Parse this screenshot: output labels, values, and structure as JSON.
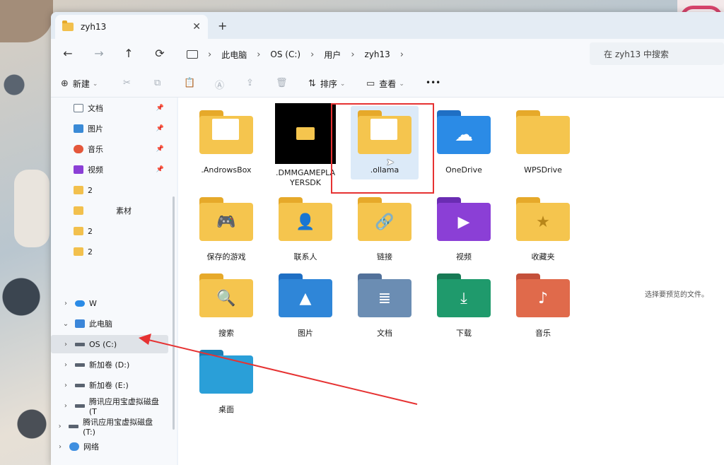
{
  "tab": {
    "title": "zyh13",
    "close": "✕",
    "new": "+"
  },
  "nav": {
    "back": "←",
    "forward": "→",
    "up": "↑",
    "refresh": "⟳"
  },
  "path": {
    "segments": [
      "此电脑",
      "OS (C:)",
      "用户",
      "zyh13"
    ],
    "sep": "›",
    "end": "›"
  },
  "search": {
    "placeholder": "在 zyh13 中搜索"
  },
  "toolbar": {
    "new": "新建",
    "new_icon": "⊕",
    "caret": "⌄",
    "cut_icon": "✂",
    "copy_icon": "⧉",
    "paste_icon": "📋",
    "rename_icon": "Ⓐ",
    "share_icon": "⇪",
    "delete_icon": "🗑",
    "sort_icon": "⇅",
    "sort": "排序",
    "view_icon": "▭",
    "view": "查看",
    "more": "•••"
  },
  "sidebar": {
    "quick": [
      {
        "label": "文档",
        "icon": "doc",
        "pin": "📌"
      },
      {
        "label": "图片",
        "icon": "pic",
        "pin": "📌"
      },
      {
        "label": "音乐",
        "icon": "music",
        "pin": "📌"
      },
      {
        "label": "视频",
        "icon": "video",
        "pin": "📌"
      },
      {
        "label": "2",
        "icon": "folder"
      },
      {
        "label": "素材",
        "icon": "folder"
      },
      {
        "label": "2",
        "icon": "folder"
      },
      {
        "label": "2",
        "icon": "folder"
      }
    ],
    "tree": [
      {
        "label": "W",
        "icon": "cloud",
        "chev": "›"
      },
      {
        "label": "此电脑",
        "icon": "pc",
        "chev": "⌄"
      },
      {
        "label": "OS (C:)",
        "icon": "drive",
        "chev": "›"
      },
      {
        "label": "新加卷 (D:)",
        "icon": "drive",
        "chev": "›"
      },
      {
        "label": "新加卷 (E:)",
        "icon": "drive",
        "chev": "›"
      },
      {
        "label": "腾讯应用宝虚拟磁盘 (T",
        "icon": "drive",
        "chev": "›"
      },
      {
        "label": "腾讯应用宝虚拟磁盘 (T:)",
        "icon": "drive",
        "chev": "›"
      },
      {
        "label": "网络",
        "icon": "net",
        "chev": "›"
      }
    ]
  },
  "items": [
    {
      "label": ".AndrowsBox",
      "kind": "folder-paper"
    },
    {
      "label": ".DMMGAMEPLAYERSDK",
      "kind": "black-thumb"
    },
    {
      "label": ".ollama",
      "kind": "folder-paper",
      "selected": true
    },
    {
      "label": "OneDrive",
      "kind": "onedrive",
      "color": "#2b8be6"
    },
    {
      "label": "WPSDrive",
      "kind": "folder"
    },
    {
      "label": "保存的游戏",
      "kind": "games",
      "glyph": "🎮"
    },
    {
      "label": "联系人",
      "kind": "contacts",
      "glyph": "👤"
    },
    {
      "label": "链接",
      "kind": "links",
      "glyph": "🔗"
    },
    {
      "label": "视频",
      "kind": "videos",
      "glyph": "▶",
      "color": "#8b3fd6"
    },
    {
      "label": "收藏夹",
      "kind": "favorites",
      "glyph": "★"
    },
    {
      "label": "搜索",
      "kind": "searches",
      "glyph": "🔍"
    },
    {
      "label": "图片",
      "kind": "pictures",
      "glyph": "▲",
      "color": "#2f86d8"
    },
    {
      "label": "文档",
      "kind": "documents",
      "glyph": "≣",
      "color": "#6b8db3"
    },
    {
      "label": "下载",
      "kind": "downloads",
      "glyph": "⤓",
      "color": "#1f9a6c"
    },
    {
      "label": "音乐",
      "kind": "music",
      "glyph": "♪",
      "color": "#e06a4b"
    },
    {
      "label": "桌面",
      "kind": "desktop",
      "glyph": "",
      "color": "#2a9fd8"
    }
  ],
  "preview": {
    "empty_text": "选择要预览的文件。"
  }
}
